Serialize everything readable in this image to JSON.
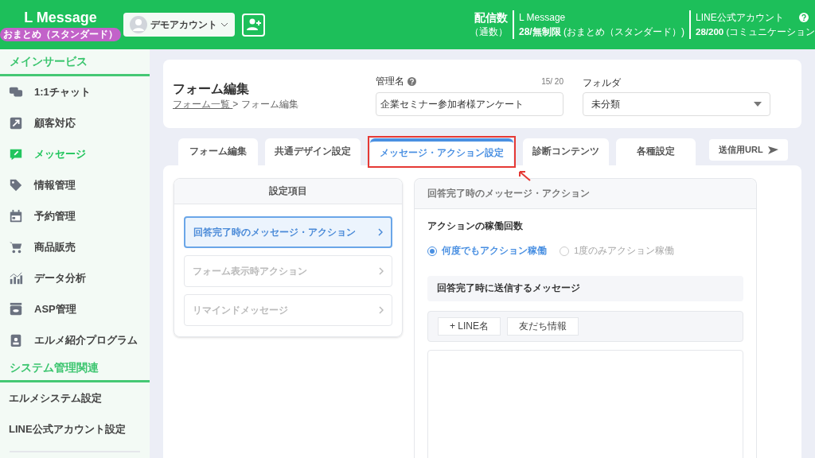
{
  "header": {
    "logo": "L Message",
    "plan_badge": "おまとめ（スタンダード）",
    "account": "デモアカウント",
    "delivery_label": "配信数",
    "delivery_sub": "（通数）",
    "lmessage_label": "L Message",
    "lmessage_value": "**28/無制限** (おまとめ（スタンダード）)",
    "line_label": "LINE公式アカウント",
    "line_value": "**28/200** (コミュニケーション"
  },
  "sidebar": {
    "sections": [
      {
        "title": "メインサービス",
        "items": [
          {
            "label": "1:1チャット",
            "kind": "chat",
            "selected": false
          },
          {
            "label": "顧客対応",
            "kind": "arrow",
            "selected": false
          },
          {
            "label": "メッセージ",
            "kind": "message",
            "selected": true
          },
          {
            "label": "情報管理",
            "kind": "tag",
            "selected": false
          },
          {
            "label": "予約管理",
            "kind": "calendar",
            "selected": false
          },
          {
            "label": "商品販売",
            "kind": "cart",
            "selected": false
          },
          {
            "label": "データ分析",
            "kind": "chart",
            "selected": false
          },
          {
            "label": "ASP管理",
            "kind": "box",
            "selected": false
          },
          {
            "label": "エルメ紹介プログラム",
            "kind": "badge",
            "selected": false
          }
        ]
      },
      {
        "title": "システム管理関連",
        "items": [
          {
            "label": "エルメシステム設定",
            "selected": false
          },
          {
            "label": "LINE公式アカウント設定",
            "selected": false
          }
        ]
      }
    ]
  },
  "form_header": {
    "title": "フォーム編集",
    "breadcrumb": [
      {
        "label": "フォーム一覧 ",
        "link": true
      },
      {
        "label": "> フォーム編集",
        "link": false
      }
    ],
    "name_label": "管理名",
    "name_count": "15/ 20",
    "name_value": "企業セミナー参加者様アンケート",
    "folder_label": "フォルダ",
    "folder_value": "未分類"
  },
  "tabs": [
    {
      "label": "フォーム編集",
      "selected": false,
      "highlighted": false
    },
    {
      "label": "共通デザイン設定",
      "selected": false,
      "highlighted": false
    },
    {
      "label": "メッセージ・アクション設定",
      "selected": true,
      "highlighted": true
    },
    {
      "label": "診断コンテンツ",
      "selected": false,
      "highlighted": false
    },
    {
      "label": "各種設定",
      "selected": false,
      "highlighted": false
    }
  ],
  "url_button": "送信用URL",
  "settings": {
    "title": "設定項目",
    "items": [
      {
        "label": "回答完了時のメッセージ・アクション",
        "selected": true
      },
      {
        "label": "フォーム表示時アクション",
        "selected": false
      },
      {
        "label": "リマインドメッセージ",
        "selected": false
      }
    ]
  },
  "detail": {
    "title": "回答完了時のメッセージ・アクション",
    "count_label": "アクションの稼働回数",
    "options": [
      {
        "label": "何度でもアクション稼働",
        "selected": true
      },
      {
        "label": "1度のみアクション稼働",
        "selected": false
      }
    ],
    "message_label": "回答完了時に送信するメッセージ",
    "insert_buttons": [
      "+ LINE名",
      "友だち情報"
    ]
  }
}
